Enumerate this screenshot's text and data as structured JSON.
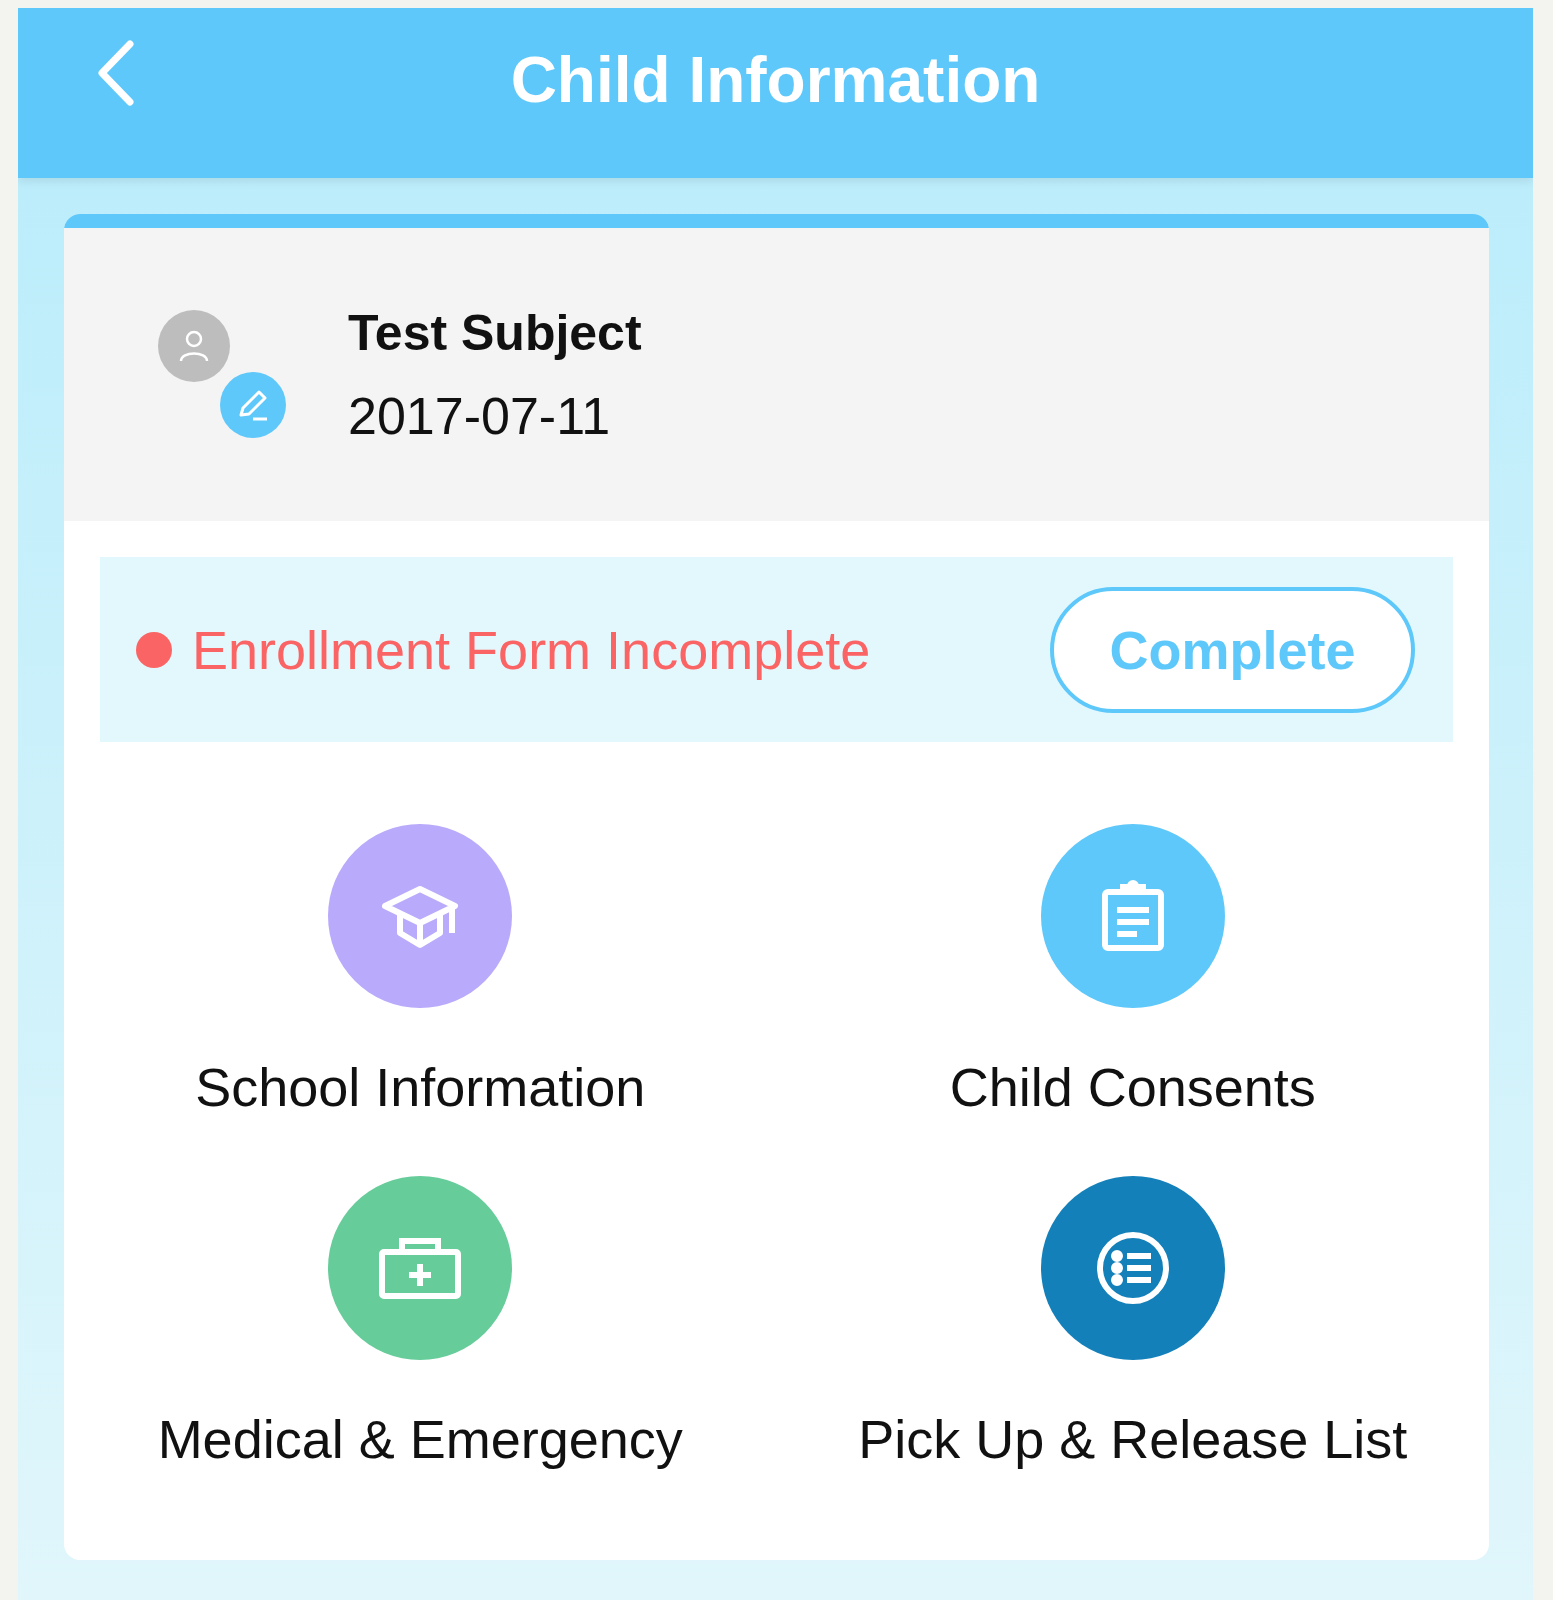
{
  "header": {
    "title": "Child Information"
  },
  "child": {
    "name": "Test Subject",
    "birth_date": "2017-07-11"
  },
  "enrollment": {
    "status": "Enrollment Form Incomplete",
    "complete": false,
    "action": "Complete"
  },
  "menu": [
    {
      "label": "School Information",
      "kind": "school",
      "color": "#baaafb"
    },
    {
      "label": "Child Consents",
      "kind": "consents",
      "color": "#5ec8fa"
    },
    {
      "label": "Medical & Emergency",
      "kind": "medical",
      "color": "#66cc9a"
    },
    {
      "label": "Pick Up & Release List",
      "kind": "list",
      "color": "#1380ba"
    }
  ]
}
